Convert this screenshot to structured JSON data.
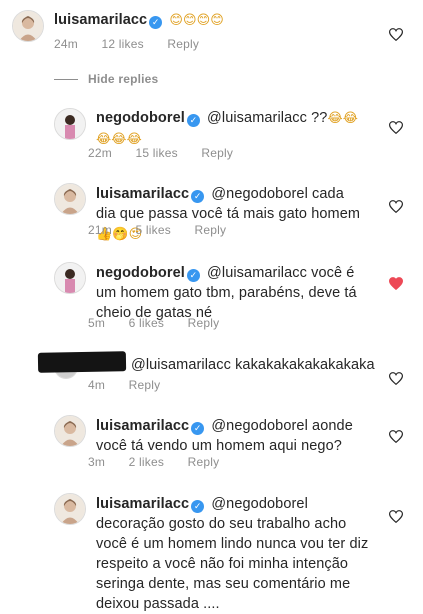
{
  "hide_replies": "Hide replies",
  "comments": [
    {
      "id": "c0",
      "username": "luisamarilacc",
      "verified": true,
      "mention": "",
      "text": "",
      "emoji": "😊😊😊😊",
      "time": "24m",
      "likes": "12 likes",
      "reply": "Reply",
      "liked": false,
      "avatar": "luisa"
    },
    {
      "id": "c1",
      "username": "negodoborel",
      "verified": true,
      "mention": "@luisamarilacc",
      "text": "??",
      "emoji": "😂😂😂😂😂",
      "time": "22m",
      "likes": "15 likes",
      "reply": "Reply",
      "liked": false,
      "avatar": "borel"
    },
    {
      "id": "c2",
      "username": "luisamarilacc",
      "verified": true,
      "mention": "@negodoborel",
      "text": "cada dia que passa você tá mais gato homem",
      "emoji": "👍🤭😍",
      "time": "21m",
      "likes": "5 likes",
      "reply": "Reply",
      "liked": false,
      "avatar": "luisa"
    },
    {
      "id": "c3",
      "username": "negodoborel",
      "verified": true,
      "mention": "@luisamarilacc",
      "text": "você é um homem gato tbm, parabéns, deve tá cheio de gatas né",
      "emoji": "",
      "time": "5m",
      "likes": "6 likes",
      "reply": "Reply",
      "liked": true,
      "avatar": "borel"
    },
    {
      "id": "c4",
      "username": "",
      "verified": false,
      "mention": "@luisamarilacc",
      "text": "kakakakakakakakaka",
      "emoji": "",
      "time": "4m",
      "likes": "",
      "reply": "Reply",
      "liked": false,
      "avatar": "redacted"
    },
    {
      "id": "c5",
      "username": "luisamarilacc",
      "verified": true,
      "mention": "@negodoborel",
      "text": "aonde você tá vendo um homem aqui nego?",
      "emoji": "",
      "time": "3m",
      "likes": "2 likes",
      "reply": "Reply",
      "liked": false,
      "avatar": "luisa"
    },
    {
      "id": "c6",
      "username": "luisamarilacc",
      "verified": true,
      "mention": "@negodoborel",
      "text": "decoração gosto do seu trabalho acho você é um homem lindo nunca vou ter diz respeito a você não foi minha intenção seringa dente, mas seu comentário me deixou passada ....",
      "emoji": "",
      "time": "",
      "likes": "",
      "reply": "",
      "liked": false,
      "avatar": "luisa"
    }
  ],
  "colors": {
    "heart_liked": "#ed4956",
    "meta": "#8e8e8e",
    "verified": "#3897f0"
  }
}
